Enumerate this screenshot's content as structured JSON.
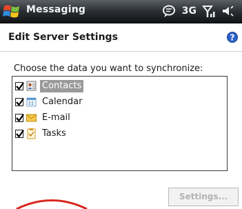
{
  "titlebar": {
    "app_title": "Messaging",
    "network_label": "3G"
  },
  "header": {
    "title": "Edit Server Settings",
    "help_icon": "help-icon"
  },
  "prompt": "Choose the data you want to synchronize:",
  "items": [
    {
      "label": "Contacts",
      "checked": true,
      "selected": true,
      "icon": "contacts-icon"
    },
    {
      "label": "Calendar",
      "checked": true,
      "selected": false,
      "icon": "calendar-icon"
    },
    {
      "label": "E-mail",
      "checked": true,
      "selected": false,
      "icon": "email-icon"
    },
    {
      "label": "Tasks",
      "checked": true,
      "selected": false,
      "icon": "tasks-icon"
    }
  ],
  "settings_button": {
    "label": "Settings...",
    "enabled": false
  },
  "colors": {
    "selection": "#9a9a9a",
    "annotation": "#d9261c"
  }
}
